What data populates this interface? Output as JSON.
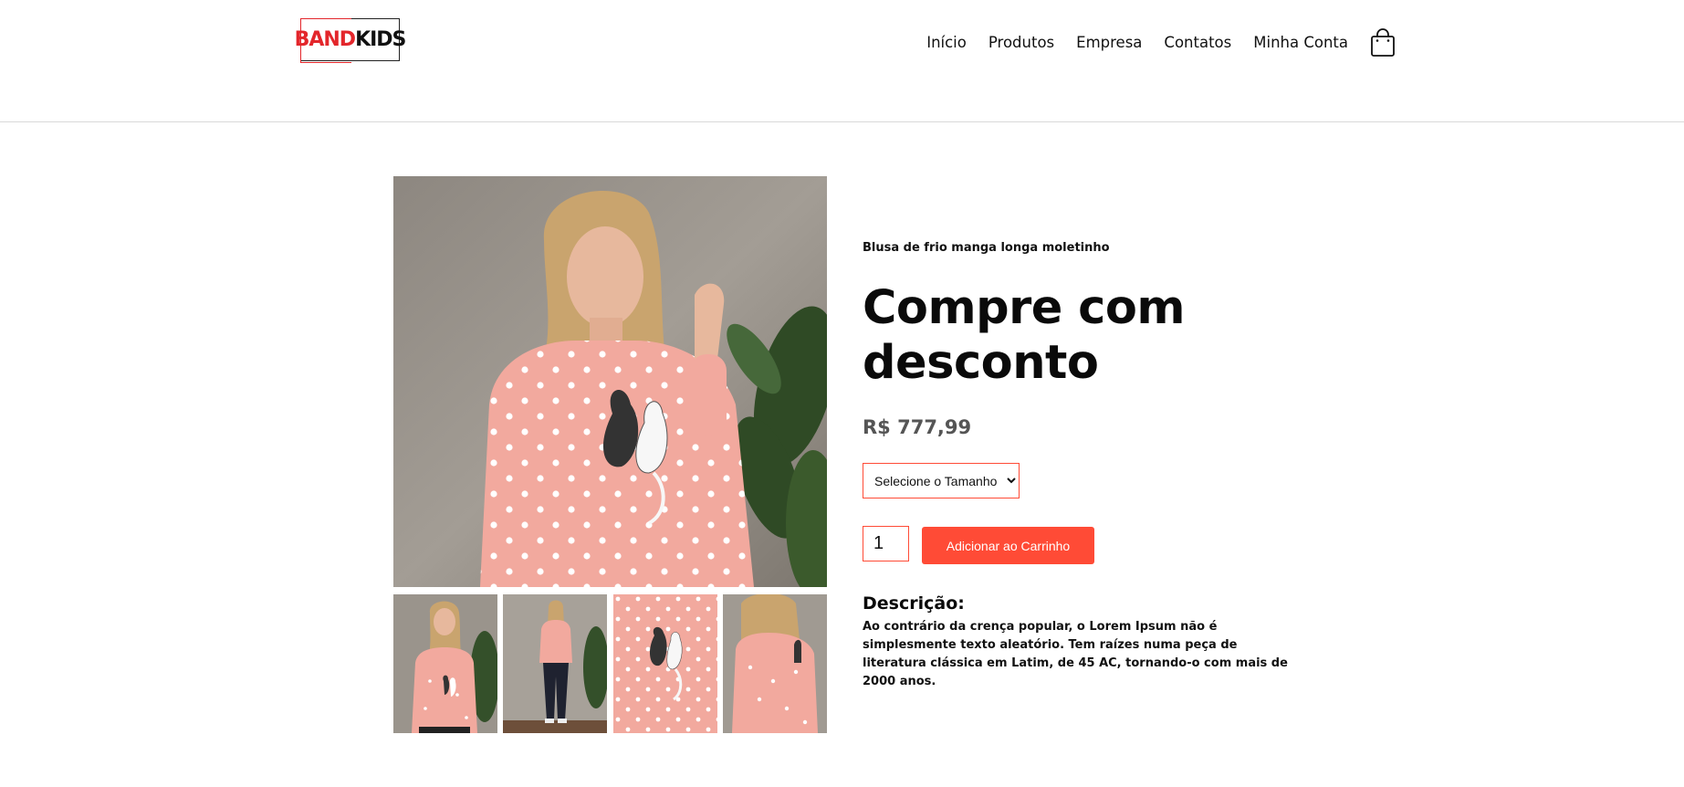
{
  "brand": {
    "logo_part1": "BAND",
    "logo_part2": "KIDS",
    "accent": "#e3262b"
  },
  "nav": {
    "items": [
      {
        "label": "Início"
      },
      {
        "label": "Produtos"
      },
      {
        "label": "Empresa"
      },
      {
        "label": "Contatos"
      },
      {
        "label": "Minha Conta"
      }
    ],
    "cart_icon": "shopping-bag-icon"
  },
  "product": {
    "subtitle": "Blusa de frio manga longa moletinho",
    "title": "Compre com desconto",
    "price": "R$ 777,99",
    "size_select": {
      "selected": "Selecione o Tamanho",
      "options": [
        "Selecione o Tamanho"
      ]
    },
    "quantity": "1",
    "add_to_cart_label": "Adicionar ao Carrinho",
    "description_title": "Descrição:",
    "description_text": "Ao contrário da crença popular, o Lorem Ipsum não é simplesmente texto aleatório. Tem raízes numa peça de literatura clássica em Latim, de 45 AC, tornando-o com mais de 2000 anos."
  },
  "colors": {
    "button": "#ff4b36",
    "sweater": "#f2a99e"
  }
}
